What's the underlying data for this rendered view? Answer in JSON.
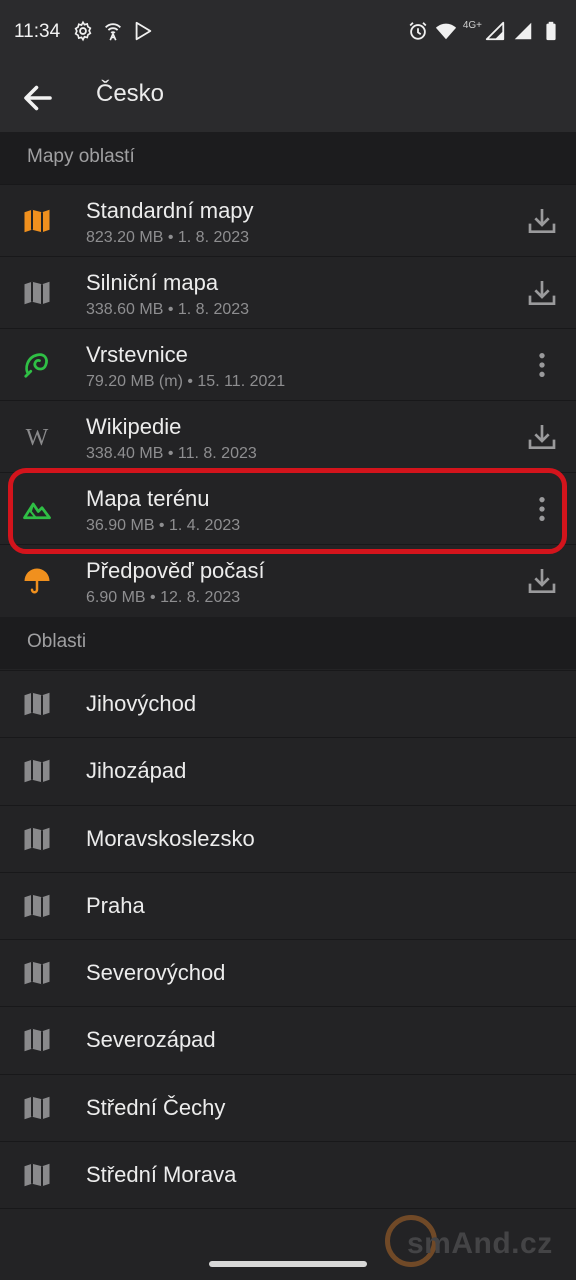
{
  "status_bar": {
    "time": "11:34",
    "left_icons": [
      "settings-icon",
      "wifi-tower-icon",
      "play-icon"
    ],
    "right_icons": [
      "alarm-icon",
      "wifi-icon",
      "signal-4g-icon",
      "signal-icon",
      "battery-icon"
    ],
    "network_label": "4G+"
  },
  "app_bar": {
    "back_icon": "arrow-left-icon",
    "title": "Česko"
  },
  "sections": {
    "maps_header": "Mapy oblastí",
    "regions_header": "Oblasti"
  },
  "maps": [
    {
      "title": "Standardní mapy",
      "subtitle": "823.20 MB • 1. 8. 2023",
      "icon": "map-icon",
      "icon_color": "#f0901e",
      "action": "download-icon"
    },
    {
      "title": "Silniční mapa",
      "subtitle": "338.60 MB • 1. 8. 2023",
      "icon": "map-icon",
      "icon_color": "#8a8a8c",
      "action": "download-icon"
    },
    {
      "title": "Vrstevnice",
      "subtitle": "79.20 MB (m) • 15. 11. 2021",
      "icon": "contour-icon",
      "icon_color": "#2fbf45",
      "action": "more-vert-icon"
    },
    {
      "title": "Wikipedie",
      "subtitle": "338.40 MB • 11. 8. 2023",
      "icon": "wikipedia-icon",
      "icon_color": "#8a8a8c",
      "action": "download-icon",
      "icon_text": "W"
    },
    {
      "title": "Mapa terénu",
      "subtitle": "36.90 MB • 1. 4. 2023",
      "icon": "terrain-icon",
      "icon_color": "#2fbf45",
      "action": "more-vert-icon"
    },
    {
      "title": "Předpověď počasí",
      "subtitle": "6.90 MB • 12. 8. 2023",
      "icon": "umbrella-icon",
      "icon_color": "#f0901e",
      "action": "download-icon"
    }
  ],
  "regions": [
    {
      "title": "Jihovýchod"
    },
    {
      "title": "Jihozápad"
    },
    {
      "title": "Moravskoslezsko"
    },
    {
      "title": "Praha"
    },
    {
      "title": "Severovýchod"
    },
    {
      "title": "Severozápad"
    },
    {
      "title": "Střední Čechy"
    },
    {
      "title": "Střední Morava"
    }
  ],
  "colors": {
    "highlight": "#d3141c",
    "accent_orange": "#f0901e",
    "accent_green": "#2fbf45"
  },
  "watermark": "smAnd.cz"
}
